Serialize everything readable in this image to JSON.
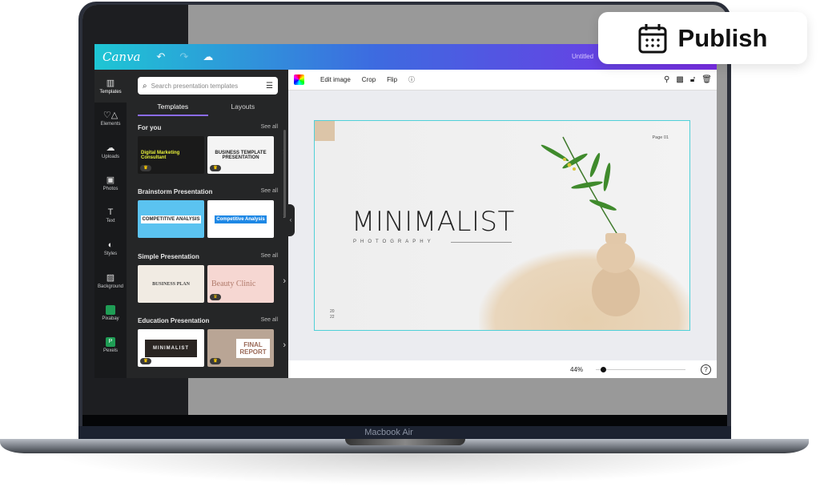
{
  "publish": {
    "label": "Publish",
    "icon": "calendar-icon"
  },
  "device": {
    "label": "Macbook Air"
  },
  "header": {
    "logo": "Canva",
    "doc_title": "Untitled",
    "icons": [
      "undo-icon",
      "redo-icon",
      "cloud-saved-icon"
    ]
  },
  "rail": [
    {
      "label": "Templates",
      "icon": "▥"
    },
    {
      "label": "Elements",
      "icon": "♡△"
    },
    {
      "label": "Uploads",
      "icon": "☁"
    },
    {
      "label": "Photos",
      "icon": "▣"
    },
    {
      "label": "Text",
      "icon": "T"
    },
    {
      "label": "Styles",
      "icon": "◐"
    },
    {
      "label": "Background",
      "icon": "▨"
    },
    {
      "label": "Pixabay",
      "icon": "▪"
    },
    {
      "label": "Pexels",
      "icon": "P"
    }
  ],
  "panel": {
    "search_placeholder": "Search presentation templates",
    "tabs": [
      "Templates",
      "Layouts"
    ],
    "see_all": "See all",
    "sections": [
      {
        "title": "For you",
        "thumbs": [
          "Digital Marketing Consultant",
          "BUSINESS TEMPLATE PRESENTATION"
        ]
      },
      {
        "title": "Brainstorm Presentation",
        "thumbs": [
          "COMPETITIVE ANALYSIS",
          "Competitive Analysis"
        ]
      },
      {
        "title": "Simple Presentation",
        "thumbs": [
          "BUSINESS PLAN",
          "Beauty Clinic"
        ]
      },
      {
        "title": "Education Presentation",
        "thumbs": [
          "MINIMALIST",
          "FINAL REPORT"
        ]
      }
    ]
  },
  "toolbar": {
    "edit_image": "Edit image",
    "crop": "Crop",
    "flip": "Flip"
  },
  "slide": {
    "page": "Page 01",
    "title": "MINIMALIST",
    "subtitle": "PHOTOGRAPHY",
    "year_top": "20",
    "year_bottom": "22"
  },
  "footer": {
    "zoom": "44%",
    "zoom_fraction": 0.05,
    "help": "?"
  },
  "colors": {
    "accent": "#8b6cf0",
    "selection": "#4fd0d8",
    "header_start": "#1ec6d4",
    "header_end": "#7a2ee6"
  }
}
